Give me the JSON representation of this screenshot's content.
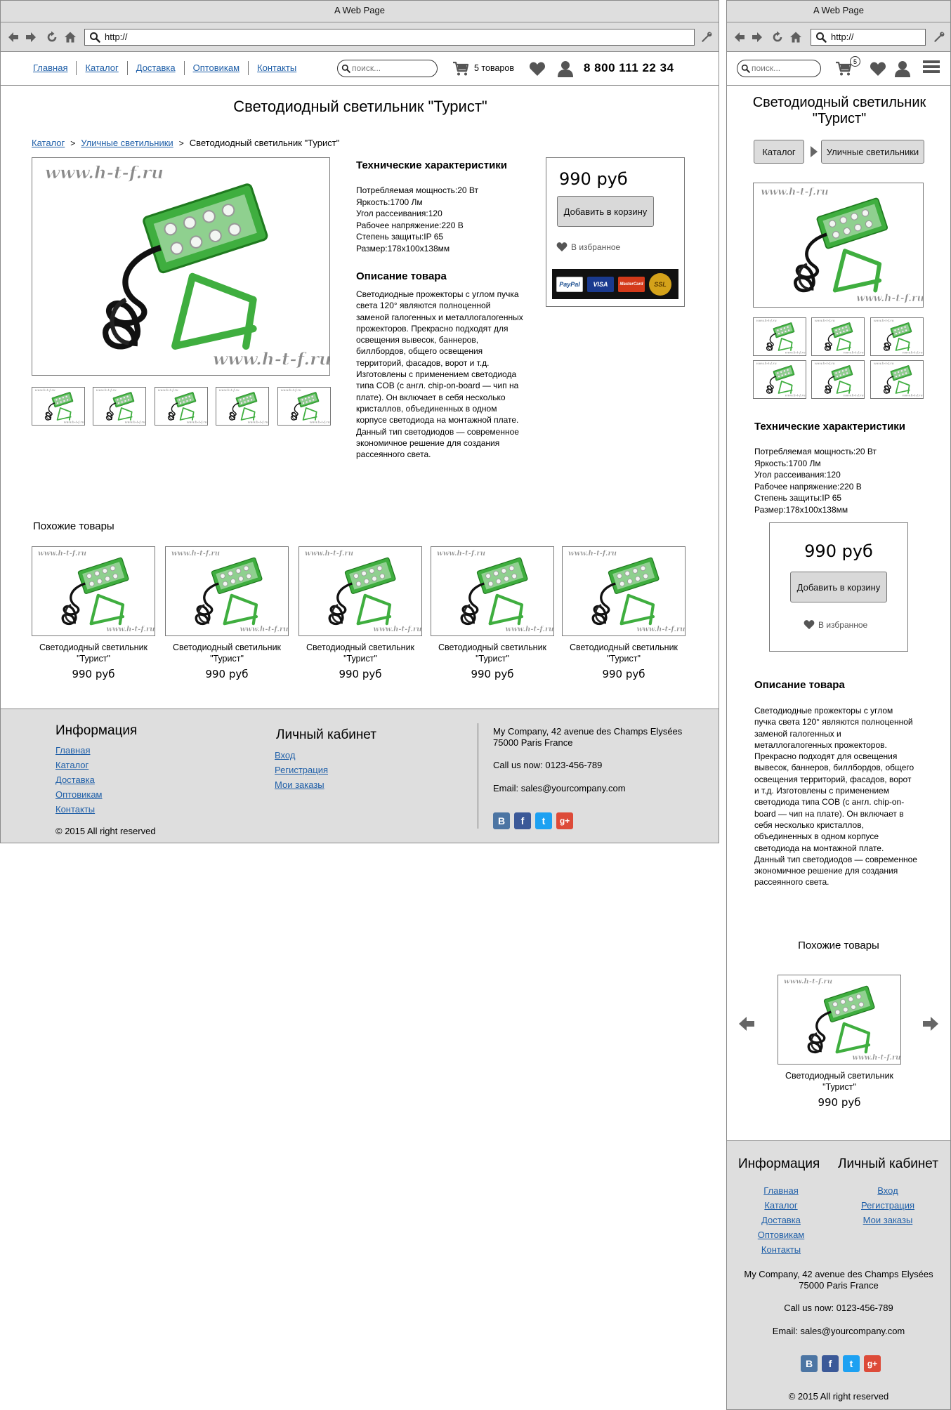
{
  "browser": {
    "title": "A Web Page",
    "url": "http://"
  },
  "nav": [
    "Главная",
    "Каталог",
    "Доставка",
    "Оптовикам",
    "Контакты"
  ],
  "search": {
    "placeholder": "поиск..."
  },
  "cart": {
    "label": "5 товаров",
    "count": "5"
  },
  "phone": "8 800 111 22 34",
  "product": {
    "title": "Светодиодный светильник \"Турист\"",
    "breadcrumbs": [
      "Каталог",
      "Уличные светильники",
      "Светодиодный светильник \"Турист\""
    ],
    "watermark": "www.h-t-f.ru",
    "specs_title": "Технические характеристики",
    "specs": [
      "Потребляемая мощность:20 Вт",
      "Яркость:1700 Лм",
      "Угол рассеивания:120",
      "Рабочее напряжение:220 В",
      "Степень защиты:IP 65",
      "Размер:178х100х138мм"
    ],
    "desc_title": "Описание товара",
    "desc_lines": [
      "Светодиодные прожекторы с углом пучка",
      "света 120° являются полноценной",
      "заменой галогенных и металлогалогенных",
      "прожекторов. Прекрасно подходят для",
      "освещения вывесок, баннеров,",
      "биллбордов, общего освещения",
      "территорий, фасадов, ворот и т.д.",
      "Изготовлены с применением светодиода",
      "типа COB (с англ. chip-on-board — чип на",
      "плате). Он включает в себя несколько",
      "кристаллов, объединенных в одном",
      "корпусе светодиода на монтажной плате.",
      "Данный тип светодиодов — современное",
      "экономичное решение для создания",
      "рассеянного света."
    ],
    "desc_lines_mobile": [
      "Светодиодные прожекторы с углом",
      "пучка света 120° являются полноценной",
      "заменой галогенных и",
      "металлогалогенных прожекторов.",
      "Прекрасно подходят для освещения",
      "вывесок, баннеров, биллбордов, общего",
      "освещения территорий, фасадов, ворот",
      "и т.д. Изготовлены с применением",
      "светодиода типа COB (с англ. chip-on-",
      "board — чип на плате). Он включает в",
      "себя несколько кристаллов,",
      "объединенных в одном корпусе",
      "светодиода на монтажной плате.",
      "Данный тип светодиодов — современное",
      "экономичное решение для создания",
      "рассеянного света."
    ],
    "price": "990 руб",
    "add_to_cart": "Добавить в корзину",
    "favorite": "В избранное",
    "payments": [
      "PayPal",
      "VISA",
      "MasterCard",
      "SSL"
    ]
  },
  "similar": {
    "title": "Похожие товары",
    "items": [
      {
        "name_l1": "Светодиодный светильник",
        "name_l2": "\"Турист\"",
        "price": "990 руб"
      },
      {
        "name_l1": "Светодиодный светильник",
        "name_l2": "\"Турист\"",
        "price": "990 руб"
      },
      {
        "name_l1": "Светодиодный светильник",
        "name_l2": "\"Турист\"",
        "price": "990 руб"
      },
      {
        "name_l1": "Светодиодный светильник",
        "name_l2": "\"Турист\"",
        "price": "990 руб"
      },
      {
        "name_l1": "Светодиодный светильник",
        "name_l2": "\"Турист\"",
        "price": "990 руб"
      }
    ]
  },
  "footer": {
    "info_title": "Информация",
    "info_links": [
      "Главная",
      "Каталог",
      "Доставка",
      "Оптовикам",
      "Контакты"
    ],
    "account_title": "Личный кабинет",
    "account_links": [
      "Вход",
      "Регистрация",
      "Мои заказы"
    ],
    "address_l1": "My Company, 42 avenue des Champs Elysées",
    "address_l2": "75000 Paris France",
    "phone": "Call us now: 0123-456-789",
    "email": "Email: sales@yourcompany.com",
    "social": [
      "В",
      "f",
      "t",
      "g+"
    ],
    "copyright": "© 2015 All right reserved"
  },
  "colors": {
    "chrome": "#dedede",
    "link": "#1f5fa8",
    "product_green": "#3fae3f",
    "vk": "#4c75a3",
    "fb": "#3b5998",
    "tw": "#1da1f2",
    "gplus": "#dd4b39"
  }
}
